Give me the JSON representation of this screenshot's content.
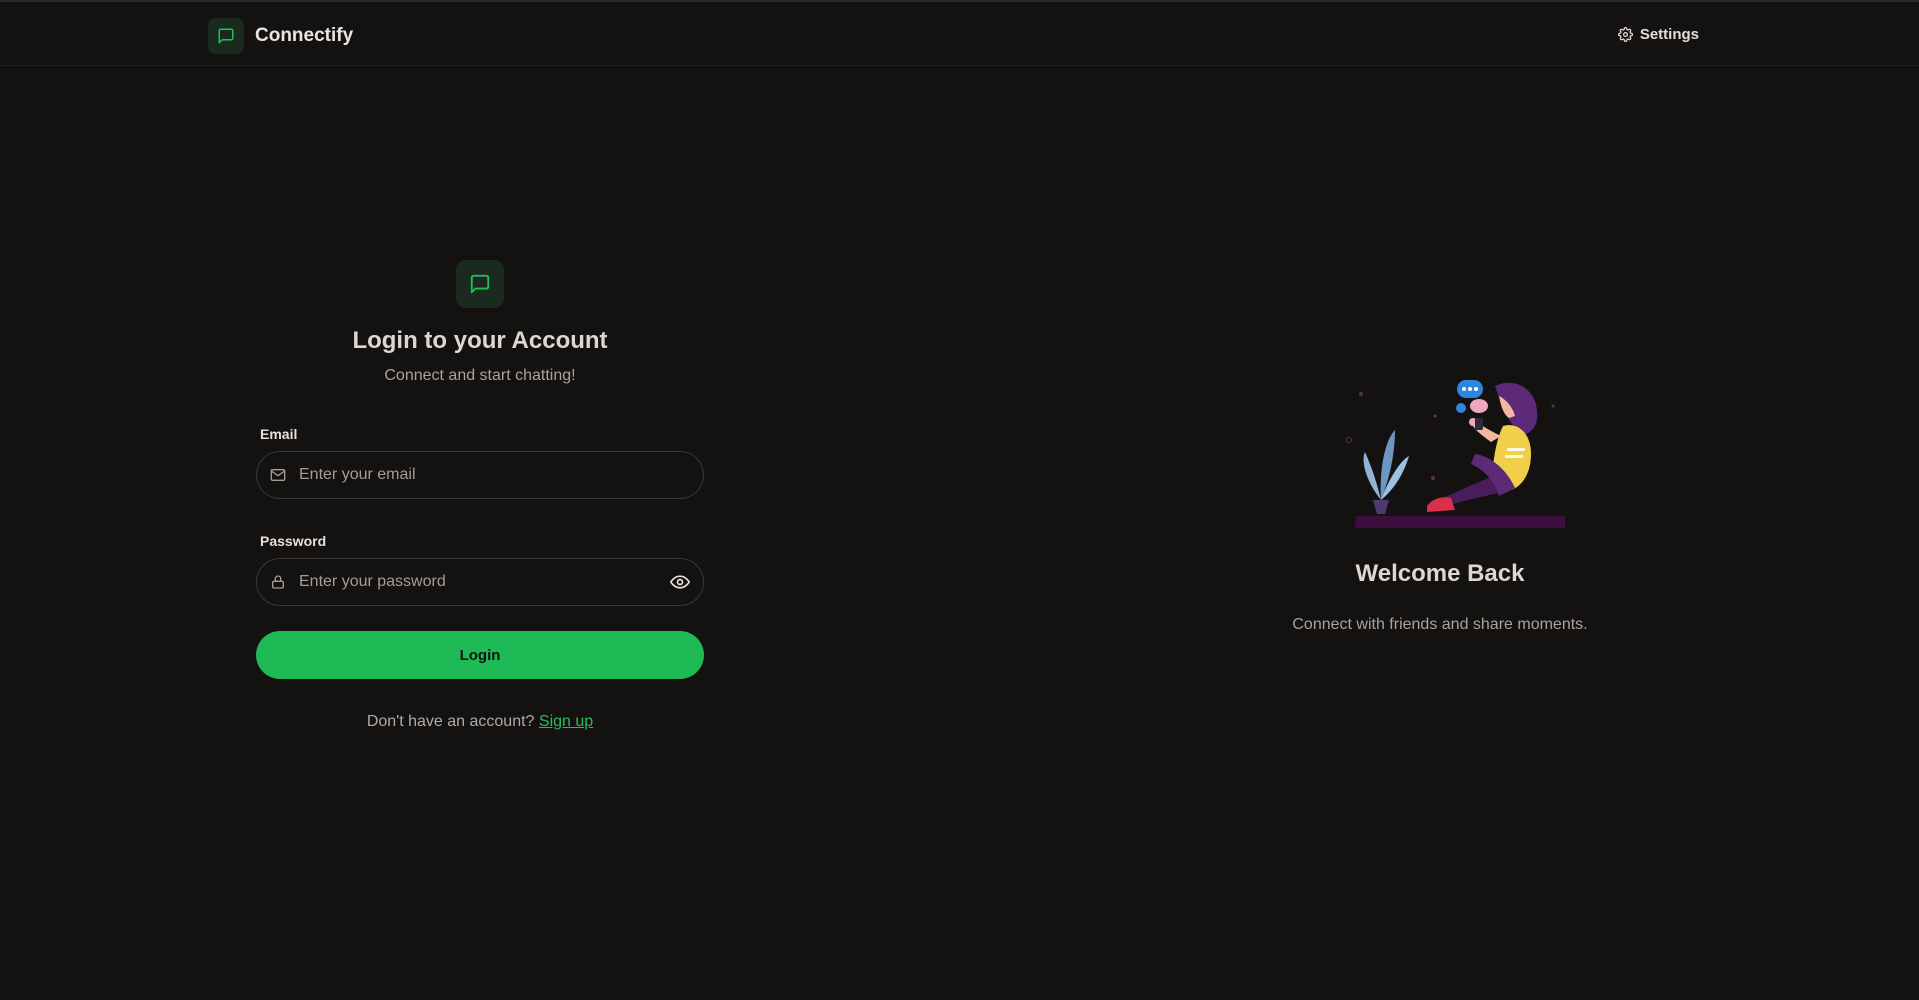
{
  "header": {
    "brand_name": "Connectify",
    "settings_label": "Settings"
  },
  "login": {
    "title": "Login to your Account",
    "subtitle": "Connect and start chatting!",
    "email": {
      "label": "Email",
      "placeholder": "Enter your email",
      "value": ""
    },
    "password": {
      "label": "Password",
      "placeholder": "Enter your password",
      "value": ""
    },
    "button_label": "Login",
    "signup_prompt": "Don't have an account?",
    "signup_link": "Sign up"
  },
  "welcome": {
    "title": "Welcome Back",
    "subtitle": "Connect with friends and share moments."
  },
  "icons": {
    "brand": "chat-bubble-icon",
    "settings": "gear-icon",
    "email": "mail-icon",
    "password": "lock-icon",
    "toggle_password": "eye-icon"
  },
  "colors": {
    "background": "#141111",
    "accent": "#1fb955",
    "accent_link": "#22c05a",
    "icon_bg": "#1b2a1f"
  }
}
